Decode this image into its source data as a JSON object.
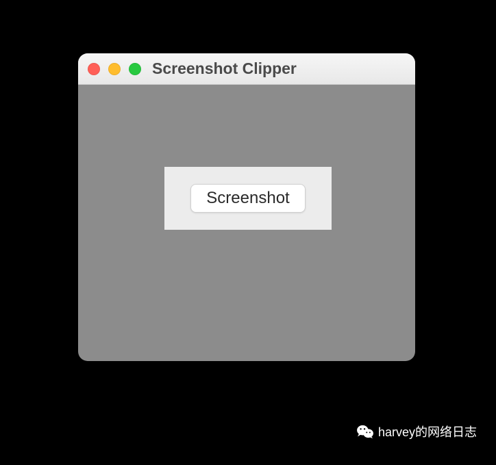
{
  "window": {
    "title": "Screenshot Clipper"
  },
  "panel": {
    "button_label": "Screenshot"
  },
  "watermark": {
    "text": "harvey的网络日志"
  }
}
